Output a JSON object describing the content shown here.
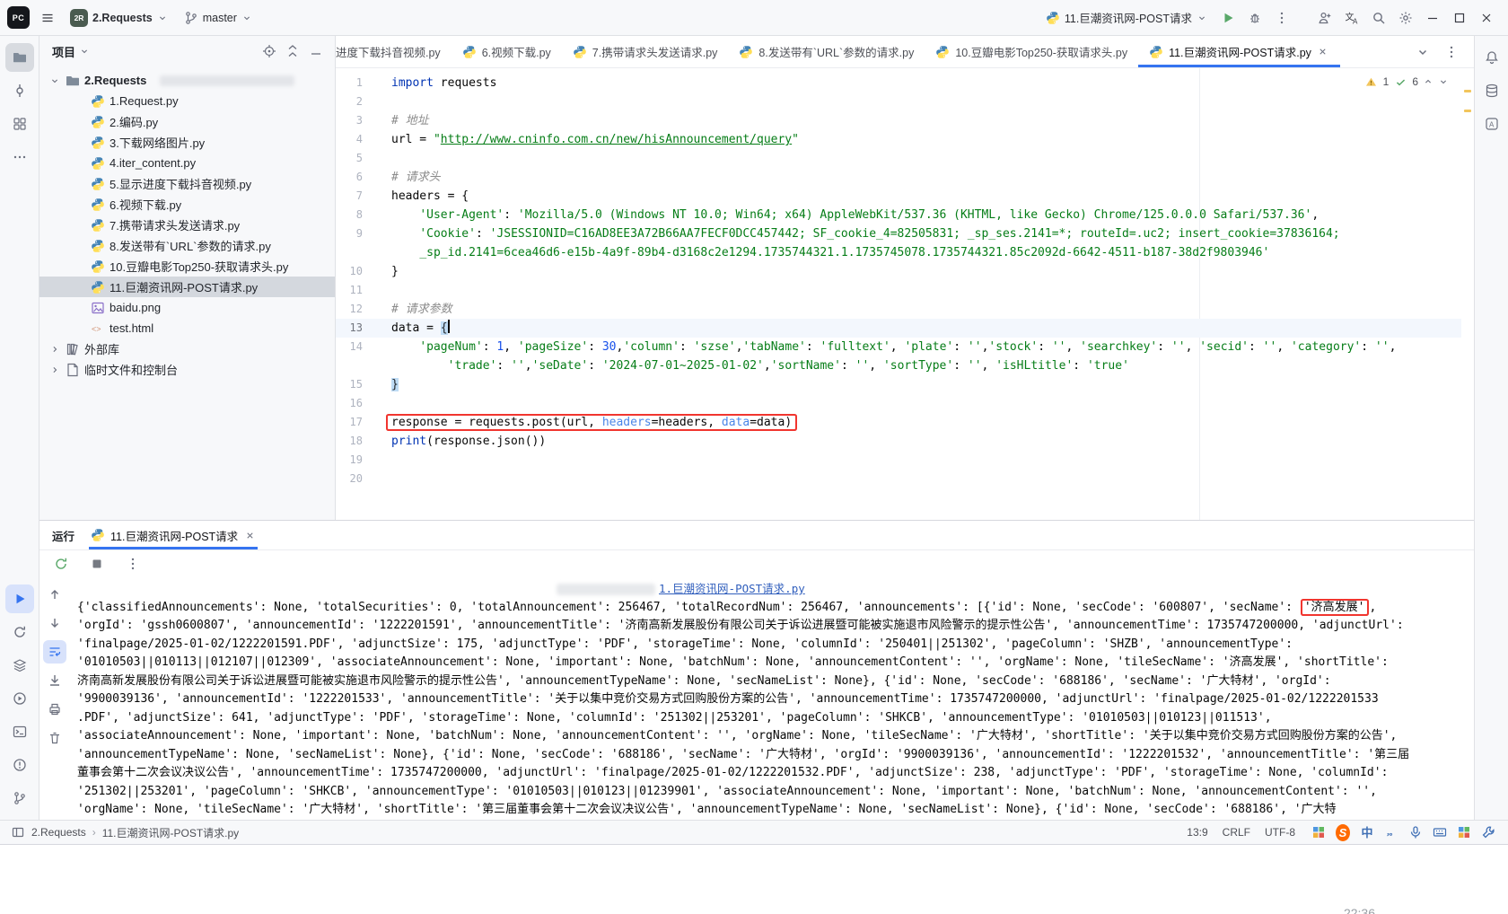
{
  "titlebar": {
    "project_badge": "2R",
    "project_name": "2.Requests",
    "branch_name": "master",
    "run_config": "11.巨潮资讯网-POST请求",
    "window_buttons": [
      {
        "name": "add-user-button",
        "icon": "user-plus"
      },
      {
        "name": "translate-button",
        "icon": "translate"
      },
      {
        "name": "search-everywhere-button",
        "icon": "search"
      },
      {
        "name": "settings-button",
        "icon": "gear"
      },
      {
        "name": "minimize-button",
        "icon": "minimize"
      },
      {
        "name": "maximize-button",
        "icon": "maximize"
      },
      {
        "name": "close-button",
        "icon": "close"
      }
    ]
  },
  "activity_bar": {
    "top": [
      {
        "name": "tool-project",
        "icon": "folder",
        "active": true
      },
      {
        "name": "tool-commit",
        "icon": "commit"
      },
      {
        "name": "tool-structure",
        "icon": "structure"
      },
      {
        "name": "tool-more",
        "icon": "more"
      }
    ],
    "bottom": [
      {
        "name": "tool-run",
        "icon": "run",
        "accent": true
      },
      {
        "name": "tool-sync",
        "icon": "sync"
      },
      {
        "name": "tool-services",
        "icon": "services"
      },
      {
        "name": "tool-python-console",
        "icon": "play-circle"
      },
      {
        "name": "tool-terminal",
        "icon": "terminal"
      },
      {
        "name": "tool-problems",
        "icon": "problems"
      },
      {
        "name": "tool-version-control",
        "icon": "branch"
      }
    ],
    "right": [
      {
        "name": "tool-notifications",
        "icon": "bell"
      },
      {
        "name": "tool-database",
        "icon": "database"
      },
      {
        "name": "tool-ai-assistant",
        "icon": "ai"
      }
    ]
  },
  "project_panel": {
    "title": "项目",
    "header_icons": [
      {
        "name": "locate-file-button",
        "icon": "target"
      },
      {
        "name": "collapse-all-button",
        "icon": "collapse"
      },
      {
        "name": "hide-panel-button",
        "icon": "hide"
      }
    ],
    "tree": [
      {
        "label": "2.Requests",
        "icon": "folder",
        "chevron": "down",
        "bold": true,
        "level": 0,
        "redacted": true
      },
      {
        "label": "1.Request.py",
        "icon": "python",
        "level": 1
      },
      {
        "label": "2.编码.py",
        "icon": "python",
        "level": 1
      },
      {
        "label": "3.下载网络图片.py",
        "icon": "python",
        "level": 1
      },
      {
        "label": "4.iter_content.py",
        "icon": "python",
        "level": 1
      },
      {
        "label": "5.显示进度下载抖音视频.py",
        "icon": "python",
        "level": 1
      },
      {
        "label": "6.视频下载.py",
        "icon": "python",
        "level": 1
      },
      {
        "label": "7.携带请求头发送请求.py",
        "icon": "python",
        "level": 1
      },
      {
        "label": "8.发送带有`URL`参数的请求.py",
        "icon": "python",
        "level": 1
      },
      {
        "label": "10.豆瓣电影Top250-获取请求头.py",
        "icon": "python",
        "level": 1
      },
      {
        "label": "11.巨潮资讯网-POST请求.py",
        "icon": "python",
        "level": 1,
        "selected": true
      },
      {
        "label": "baidu.png",
        "icon": "image",
        "level": 1
      },
      {
        "label": "test.html",
        "icon": "html",
        "level": 1
      },
      {
        "label": "外部库",
        "icon": "library",
        "chevron": "right",
        "level": 0
      },
      {
        "label": "临时文件和控制台",
        "icon": "scratch",
        "chevron": "right",
        "level": 0
      }
    ]
  },
  "editor_tabs": {
    "tabs": [
      {
        "label": "进度下载抖音视频.py",
        "icon": "python",
        "clipped": true
      },
      {
        "label": "6.视频下载.py",
        "icon": "python"
      },
      {
        "label": "7.携带请求头发送请求.py",
        "icon": "python"
      },
      {
        "label": "8.发送带有`URL`参数的请求.py",
        "icon": "python"
      },
      {
        "label": "10.豆瓣电影Top250-获取请求头.py",
        "icon": "python"
      },
      {
        "label": "11.巨潮资讯网-POST请求.py",
        "icon": "python",
        "active": true,
        "closable": true
      }
    ],
    "actions": [
      {
        "name": "tab-list-button",
        "icon": "chevron-down"
      },
      {
        "name": "tab-options-button",
        "icon": "kebab"
      }
    ]
  },
  "inspections": {
    "warnings": "1",
    "passed": "6"
  },
  "editor": {
    "lines": [
      {
        "no": "1",
        "segs": [
          [
            "import",
            "kw"
          ],
          [
            " requests",
            "pl"
          ]
        ]
      },
      {
        "no": "2",
        "segs": []
      },
      {
        "no": "3",
        "segs": [
          [
            "# 地址",
            "com"
          ]
        ]
      },
      {
        "no": "4",
        "segs": [
          [
            "url = ",
            "pl"
          ],
          [
            "\"",
            "str"
          ],
          [
            "http://www.cninfo.com.cn/new/hisAnnouncement/query",
            "url"
          ],
          [
            "\"",
            "str"
          ]
        ]
      },
      {
        "no": "5",
        "segs": []
      },
      {
        "no": "6",
        "segs": [
          [
            "# 请求头",
            "com"
          ]
        ]
      },
      {
        "no": "7",
        "segs": [
          [
            "headers = {",
            "pl"
          ]
        ]
      },
      {
        "no": "8",
        "segs": [
          [
            "    ",
            "pl"
          ],
          [
            "'User-Agent'",
            "str"
          ],
          [
            ": ",
            "pl"
          ],
          [
            "'Mozilla/5.0 (Windows NT 10.0; Win64; x64) AppleWebKit/537.36 (KHTML, like Gecko) Chrome/125.0.0.0 Safari/537.36'",
            "str"
          ],
          [
            ",",
            "pl"
          ]
        ]
      },
      {
        "no": "9",
        "segs": [
          [
            "    ",
            "pl"
          ],
          [
            "'Cookie'",
            "str"
          ],
          [
            ": ",
            "pl"
          ],
          [
            "'JSESSIONID=C16AD8EE3A72B66AA7FECF0DCC457442; SF_cookie_4=82505831; _sp_ses.2141=*; routeId=.uc2; insert_cookie=37836164;",
            "str"
          ]
        ]
      },
      {
        "no": "",
        "segs": [
          [
            "    ",
            "pl"
          ],
          [
            "_sp_id.2141=6cea46d6-e15b-4a9f-89b4-d3168c2e1294.1735744321.1.1735745078.1735744321.85c2092d-6642-4511-b187-38d2f9803946'",
            "str"
          ]
        ]
      },
      {
        "no": "10",
        "segs": [
          [
            "}",
            "pl"
          ]
        ]
      },
      {
        "no": "11",
        "segs": []
      },
      {
        "no": "12",
        "segs": [
          [
            "# 请求参数",
            "com"
          ]
        ]
      },
      {
        "no": "13",
        "current": true,
        "segs": [
          [
            "data = ",
            "pl"
          ],
          [
            "{",
            "brace"
          ],
          [
            "",
            "caret"
          ]
        ]
      },
      {
        "no": "14",
        "segs": [
          [
            "    ",
            "pl"
          ],
          [
            "'pageNum'",
            "str"
          ],
          [
            ": ",
            "pl"
          ],
          [
            "1",
            "num"
          ],
          [
            ", ",
            "pl"
          ],
          [
            "'pageSize'",
            "str"
          ],
          [
            ": ",
            "pl"
          ],
          [
            "30",
            "num"
          ],
          [
            ",",
            "pl"
          ],
          [
            "'column'",
            "str"
          ],
          [
            ": ",
            "pl"
          ],
          [
            "'szse'",
            "str"
          ],
          [
            ",",
            "pl"
          ],
          [
            "'tabName'",
            "str"
          ],
          [
            ": ",
            "pl"
          ],
          [
            "'fulltext'",
            "str"
          ],
          [
            ", ",
            "pl"
          ],
          [
            "'plate'",
            "str"
          ],
          [
            ": ",
            "pl"
          ],
          [
            "''",
            "str"
          ],
          [
            ",",
            "pl"
          ],
          [
            "'stock'",
            "str"
          ],
          [
            ": ",
            "pl"
          ],
          [
            "''",
            "str"
          ],
          [
            ", ",
            "pl"
          ],
          [
            "'searchkey'",
            "str"
          ],
          [
            ": ",
            "pl"
          ],
          [
            "''",
            "str"
          ],
          [
            ", ",
            "pl"
          ],
          [
            "'secid'",
            "str"
          ],
          [
            ": ",
            "pl"
          ],
          [
            "''",
            "str"
          ],
          [
            ", ",
            "pl"
          ],
          [
            "'category'",
            "str"
          ],
          [
            ": ",
            "pl"
          ],
          [
            "''",
            "str"
          ],
          [
            ",",
            "pl"
          ]
        ]
      },
      {
        "no": "",
        "segs": [
          [
            "        ",
            "pl"
          ],
          [
            "'trade'",
            "str"
          ],
          [
            ": ",
            "pl"
          ],
          [
            "''",
            "str"
          ],
          [
            ",",
            "pl"
          ],
          [
            "'seDate'",
            "str"
          ],
          [
            ": ",
            "pl"
          ],
          [
            "'2024-07-01~2025-01-02'",
            "str"
          ],
          [
            ",",
            "pl"
          ],
          [
            "'sortName'",
            "str"
          ],
          [
            ": ",
            "pl"
          ],
          [
            "''",
            "str"
          ],
          [
            ", ",
            "pl"
          ],
          [
            "'sortType'",
            "str"
          ],
          [
            ": ",
            "pl"
          ],
          [
            "''",
            "str"
          ],
          [
            ", ",
            "pl"
          ],
          [
            "'isHLtitle'",
            "str"
          ],
          [
            ": ",
            "pl"
          ],
          [
            "'true'",
            "str"
          ]
        ]
      },
      {
        "no": "15",
        "segs": [
          [
            "}",
            "brace"
          ]
        ]
      },
      {
        "no": "16",
        "segs": []
      },
      {
        "no": "17",
        "box": true,
        "segs": [
          [
            "response = requests.post(url, ",
            "pl"
          ],
          [
            "headers",
            "kwa"
          ],
          [
            "=headers, ",
            "pl"
          ],
          [
            "data",
            "kwa"
          ],
          [
            "=data)",
            "pl"
          ]
        ]
      },
      {
        "no": "18",
        "segs": [
          [
            "print",
            "kw"
          ],
          [
            "(response.json())",
            "pl"
          ]
        ]
      },
      {
        "no": "19",
        "segs": []
      },
      {
        "no": "20",
        "segs": []
      }
    ]
  },
  "run_panel": {
    "title": "运行",
    "tab_label": "11.巨潮资讯网-POST请求",
    "console_link": "1.巨潮资讯网-POST请求.py",
    "toolbar": [
      {
        "name": "rerun-button",
        "icon": "rerun"
      },
      {
        "name": "stop-button",
        "icon": "stop"
      },
      {
        "name": "run-more-options-button",
        "icon": "kebab"
      }
    ],
    "console_toolbar": [
      {
        "name": "scroll-up-button",
        "icon": "arrow-up"
      },
      {
        "name": "scroll-down-button",
        "icon": "arrow-down"
      },
      {
        "name": "soft-wrap-button",
        "icon": "softwrap",
        "selected": true
      },
      {
        "name": "scroll-to-end-button",
        "icon": "scroll-end"
      },
      {
        "name": "print-button",
        "icon": "printer"
      },
      {
        "name": "clear-all-button",
        "icon": "trash"
      }
    ],
    "output": [
      {
        "segs": [
          [
            "{'classifiedAnnouncements': None, 'totalSecurities': 0, 'totalAnnouncement': 256467, 'totalRecordNum': 256467, 'announcements': [{'id': None, 'secCode': '600807', 'secName': ",
            "t"
          ],
          [
            "'济高发展'",
            "boxed"
          ],
          [
            ",",
            "t"
          ]
        ]
      },
      {
        "segs": [
          [
            "'orgId': 'gssh0600807', 'announcementId': '1222201591', 'announcementTitle': '济南高新发展股份有限公司关于诉讼进展暨可能被实施退市风险警示的提示性公告', 'announcementTime': 1735747200000, 'adjunctUrl':",
            "t"
          ]
        ]
      },
      {
        "segs": [
          [
            "'finalpage/2025-01-02/1222201591.PDF', 'adjunctSize': 175, 'adjunctType': 'PDF', 'storageTime': None, 'columnId': '250401||251302', 'pageColumn': 'SHZB', 'announcementType':",
            "t"
          ]
        ]
      },
      {
        "segs": [
          [
            "'01010503||010113||012107||012309', 'associateAnnouncement': None, 'important': None, 'batchNum': None, 'announcementContent': '', 'orgName': None, 'tileSecName': '济高发展', 'shortTitle':",
            "t"
          ]
        ]
      },
      {
        "segs": [
          [
            "济南高新发展股份有限公司关于诉讼进展暨可能被实施退市风险警示的提示性公告', 'announcementTypeName': None, 'secNameList': None}, {'id': None, 'secCode': '688186', 'secName': '广大特材', 'orgId':",
            "t"
          ]
        ]
      },
      {
        "segs": [
          [
            "'9900039136', 'announcementId': '1222201533', 'announcementTitle': '关于以集中竞价交易方式回购股份方案的公告', 'announcementTime': 1735747200000, 'adjunctUrl': 'finalpage/2025-01-02/1222201533",
            "t"
          ]
        ]
      },
      {
        "segs": [
          [
            ".PDF', 'adjunctSize': 641, 'adjunctType': 'PDF', 'storageTime': None, 'columnId': '251302||253201', 'pageColumn': 'SHKCB', 'announcementType': '01010503||010123||011513',",
            "t"
          ]
        ]
      },
      {
        "segs": [
          [
            "'associateAnnouncement': None, 'important': None, 'batchNum': None, 'announcementContent': '', 'orgName': None, 'tileSecName': '广大特材', 'shortTitle': '关于以集中竞价交易方式回购股份方案的公告',",
            "t"
          ]
        ]
      },
      {
        "segs": [
          [
            "'announcementTypeName': None, 'secNameList': None}, {'id': None, 'secCode': '688186', 'secName': '广大特材', 'orgId': '9900039136', 'announcementId': '1222201532', 'announcementTitle': '第三届",
            "t"
          ]
        ]
      },
      {
        "segs": [
          [
            "董事会第十二次会议决议公告', 'announcementTime': 1735747200000, 'adjunctUrl': 'finalpage/2025-01-02/1222201532.PDF', 'adjunctSize': 238, 'adjunctType': 'PDF', 'storageTime': None, 'columnId':",
            "t"
          ]
        ]
      },
      {
        "segs": [
          [
            "'251302||253201', 'pageColumn': 'SHKCB', 'announcementType': '01010503||010123||01239901', 'associateAnnouncement': None, 'important': None, 'batchNum': None, 'announcementContent': '',",
            "t"
          ]
        ]
      },
      {
        "segs": [
          [
            "'orgName': None, 'tileSecName': '广大特材', 'shortTitle': '第三届董事会第十二次会议决议公告', 'announcementTypeName': None, 'secNameList': None}, {'id': None, 'secCode': '688186', '广大特",
            "t"
          ]
        ]
      }
    ]
  },
  "status_bar": {
    "project": "2.Requests",
    "separator": "›",
    "file": "11.巨潮资讯网-POST请求.py",
    "caret": "13:9",
    "line_separator": "CRLF",
    "encoding": "UTF-8",
    "icons": [
      {
        "name": "plugin-widget",
        "icon": "grid-color"
      },
      {
        "name": "sogou-logo",
        "icon": "sogou"
      },
      {
        "name": "ime-chinese",
        "icon": "zhong"
      },
      {
        "name": "ime-punctuation",
        "icon": "punct"
      },
      {
        "name": "ime-voice",
        "icon": "mic"
      },
      {
        "name": "ime-keyboard",
        "icon": "keyboard"
      },
      {
        "name": "ime-skin",
        "icon": "grid-color"
      },
      {
        "name": "ime-toolbox",
        "icon": "wrench"
      }
    ]
  },
  "desktop": {
    "clock": "22:36"
  },
  "colors": {
    "accent": "#3574f0",
    "keyword": "#0033b3",
    "string": "#067d17",
    "comment": "#8c8c8c",
    "number": "#1750eb",
    "annotation_red": "#f1352f"
  }
}
